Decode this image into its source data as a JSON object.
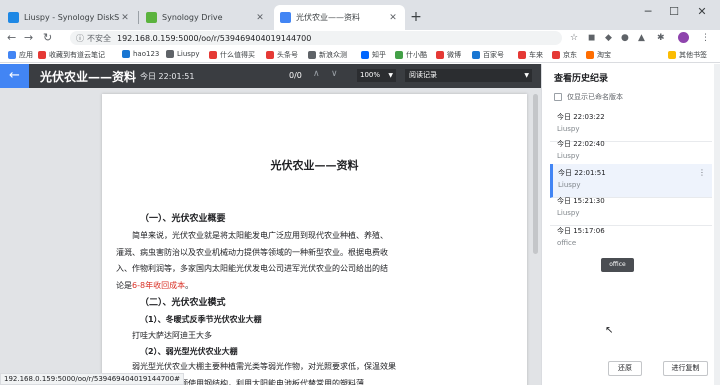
{
  "browser": {
    "tabs": [
      {
        "label": "Liuspy - Synology DiskStation",
        "fav": "#1e88e5",
        "active": false
      },
      {
        "label": "Synology Drive",
        "fav": "#5bb33e",
        "active": false
      },
      {
        "label": "光伏农业——资料",
        "fav": "#4285f4",
        "active": true
      }
    ],
    "new_tab": "+",
    "url_security": "不安全",
    "url": "192.168.0.159:5000/oo/r/539469404019144700",
    "bookmarks": [
      "应用",
      "收藏到有道云笔记",
      "hao123",
      "Liuspy",
      "什么值得买",
      "头条号",
      "新浪众测",
      "知乎",
      "什小酷",
      "微博",
      "百家号",
      "车来",
      "京东",
      "淘宝",
      "其他书签"
    ]
  },
  "app": {
    "title": "光伏农业——资料",
    "saved_time": "今日 22:01:51",
    "page_indicator": "0/0",
    "zoom": "100%",
    "mode": "阅读记录"
  },
  "document": {
    "title": "光伏农业——资料",
    "section1": "（一）、光伏农业概要",
    "para1_lines": [
      "简单来说，光伏农业就是将太阳能发电广泛应用到现代农业种植、养殖、",
      "灌溉、病虫害防治以及农业机械动力提供等领域的一种新型农业。根据电费收",
      "入、作物利润等，多家国内太阳能光伏发电公司进军光伏农业的公司给出的结"
    ],
    "para1_last": "论是",
    "para1_red": "6-8年收回成本",
    "para1_end": "。",
    "section2": "（二）、光伏农业模式",
    "sub1": "（1）、冬暖式反季节光伏农业大棚",
    "line1": "打哇大萨达阿迪王大多",
    "sub2": "（2）、弱光型光伏农业大棚",
    "para2_lines": [
      "弱光型光伏农业大棚主要种植需光类等弱光作物，对光照要求低，保温效果",
      "好，冲大棚棚体棚顶使用钢结构，利用太阳能电池板代替常用的塑料薄"
    ]
  },
  "status_url": "192.168.0.159:5000/oo/r/539469404019144700#",
  "history": {
    "title": "查看历史纪录",
    "filter_label": "仅显示已命名版本",
    "versions": [
      {
        "date": "今日 22:03:22",
        "user": "Liuspy",
        "selected": false
      },
      {
        "date": "今日 22:02:40",
        "user": "Liuspy",
        "selected": false
      },
      {
        "date": "今日 22:01:51",
        "user": "Liuspy",
        "selected": true
      },
      {
        "date": "今日 15:21:30",
        "user": "Liuspy",
        "selected": false
      },
      {
        "date": "今日 15:17:06",
        "user": "office",
        "selected": false
      }
    ],
    "tooltip": "office",
    "restore_label": "还原",
    "copy_label": "进行复制"
  }
}
